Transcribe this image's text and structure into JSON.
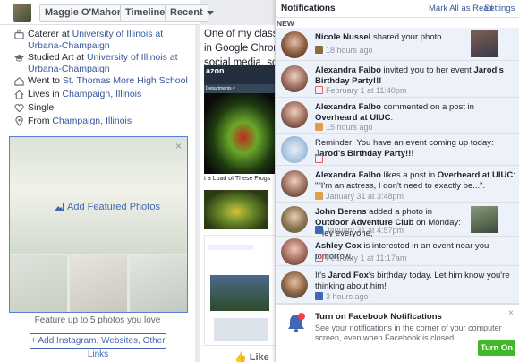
{
  "header": {
    "profile_name": "Maggie O'Mahoney",
    "timeline_label": "Timeline",
    "recent_label": "Recent"
  },
  "about": [
    {
      "icon": "briefcase-icon",
      "prefix": "Caterer at ",
      "link": "University of Illinois at Urbana-Champaign"
    },
    {
      "icon": "graduation-cap-icon",
      "prefix": "Studied Art at ",
      "link": "University of Illinois at Urbana-Champaign"
    },
    {
      "icon": "school-icon",
      "prefix": "Went to ",
      "link": "St. Thomas More High School"
    },
    {
      "icon": "home-icon",
      "prefix": "Lives in ",
      "link": "Champaign, Illinois"
    },
    {
      "icon": "heart-icon",
      "prefix": "Single",
      "link": ""
    },
    {
      "icon": "location-pin-icon",
      "prefix": "From ",
      "link": "Champaign, Illinois"
    }
  ],
  "featured": {
    "add_label": "Add Featured Photos",
    "caption": "Feature up to 5 photos you love",
    "add_links_label": "+ Add Instagram, Websites, Other Links"
  },
  "post": {
    "lines": [
      "One of my classes",
      "in Google Chrome.",
      "social media, so he"
    ],
    "amazon_logo": "azon",
    "amazon_nav": "Departments ▾",
    "frog_title": "t a Load of These Frogs",
    "like_label": "Like"
  },
  "notifications": {
    "title": "Notifications",
    "mark_all_read": "Mark All as Read",
    "separator": "·",
    "settings": "Settings",
    "new_label": "NEW",
    "items": [
      {
        "actor": "Nicole Nussel",
        "text": " shared your photo.",
        "time": "18 hours ago",
        "meta_icon": "photo-icon",
        "meta_color": "#8a6d3b"
      },
      {
        "actor": "Alexandra Falbo",
        "text": " invited you to her event ",
        "bold2": "Jarod's Birthday Party!!!",
        "time": "February 1 at 11:40pm",
        "meta_icon": "calendar-icon",
        "meta_color": "#e36060"
      },
      {
        "actor": "Alexandra Falbo",
        "text": " commented on a post in ",
        "bold2": "Overheard at UIUC",
        "tail": ".",
        "time": "15 hours ago",
        "meta_icon": "comment-icon",
        "meta_color": "#e0a040"
      },
      {
        "actor": "",
        "text": "Reminder: You have an event coming up today: ",
        "bold2": "Jarod's Birthday Party!!!",
        "time": "",
        "meta_icon": "calendar-icon",
        "meta_color": "#e36060"
      },
      {
        "actor": "Alexandra Falbo",
        "text": " likes a post in ",
        "bold2": "Overheard at UIUC",
        "tail": ": \"\"I'm an actress, I don't need to exactly be...\".",
        "time": "January 31 at 3:48pm",
        "meta_icon": "comment-icon",
        "meta_color": "#e0a040"
      },
      {
        "actor": "John Berens",
        "text": " added a photo in ",
        "bold2": "Outdoor Adventure Club",
        "tail": " on Monday: \"Hey everyone,",
        "time": "January 31 at 4:57pm",
        "meta_icon": "group-icon",
        "meta_color": "#4267b2"
      },
      {
        "actor": "Ashley Cox",
        "text": " is interested in an event near you tomorrow.",
        "time": "February 1 at 11:17am",
        "meta_icon": "calendar-icon",
        "meta_color": "#e36060"
      },
      {
        "actor": "",
        "text": "It's ",
        "bold2": "Jarod Fox",
        "tail": "'s birthday today. Let him know you're thinking about him!",
        "time": "3 hours ago",
        "meta_icon": "facebook-icon",
        "meta_color": "#4267b2"
      }
    ],
    "banner": {
      "title": "Turn on Facebook Notifications",
      "desc": "See your notifications in the corner of your computer screen, even when Facebook is closed.",
      "button": "Turn On",
      "close": "×"
    },
    "featured_close": "×"
  }
}
